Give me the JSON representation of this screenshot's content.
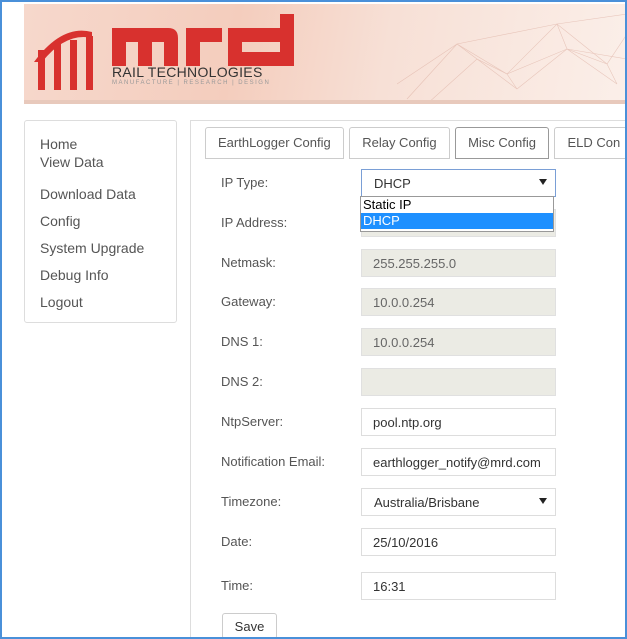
{
  "brand": {
    "logo_text": "mrd",
    "tagline": "RAIL TECHNOLOGIES",
    "sub_tagline": "MANUFACTURE | RESEARCH | DESIGN",
    "accent_color": "#d8312e"
  },
  "sidebar": {
    "items": [
      {
        "label": "Home"
      },
      {
        "label": "View Data"
      },
      {
        "label": "Download Data"
      },
      {
        "label": "Config"
      },
      {
        "label": "System Upgrade"
      },
      {
        "label": "Debug Info"
      },
      {
        "label": "Logout"
      }
    ]
  },
  "tabs": [
    {
      "label": "EarthLogger Config"
    },
    {
      "label": "Relay Config"
    },
    {
      "label": "Misc Config"
    },
    {
      "label": "ELD Con"
    }
  ],
  "form": {
    "ip_type": {
      "label": "IP Type:",
      "value": "DHCP"
    },
    "ip_type_options": [
      "Static IP",
      "DHCP"
    ],
    "ip_address": {
      "label": "IP Address:",
      "value": ""
    },
    "netmask": {
      "label": "Netmask:",
      "value": "255.255.255.0"
    },
    "gateway": {
      "label": "Gateway:",
      "value": "10.0.0.254"
    },
    "dns1": {
      "label": "DNS 1:",
      "value": "10.0.0.254"
    },
    "dns2": {
      "label": "DNS 2:",
      "value": ""
    },
    "ntp": {
      "label": "NtpServer:",
      "value": "pool.ntp.org"
    },
    "email": {
      "label": "Notification Email:",
      "value": "earthlogger_notify@mrd.com"
    },
    "timezone": {
      "label": "Timezone:",
      "value": "Australia/Brisbane"
    },
    "date": {
      "label": "Date:",
      "value": "25/10/2016"
    },
    "time": {
      "label": "Time:",
      "value": "16:31"
    },
    "save_label": "Save"
  }
}
